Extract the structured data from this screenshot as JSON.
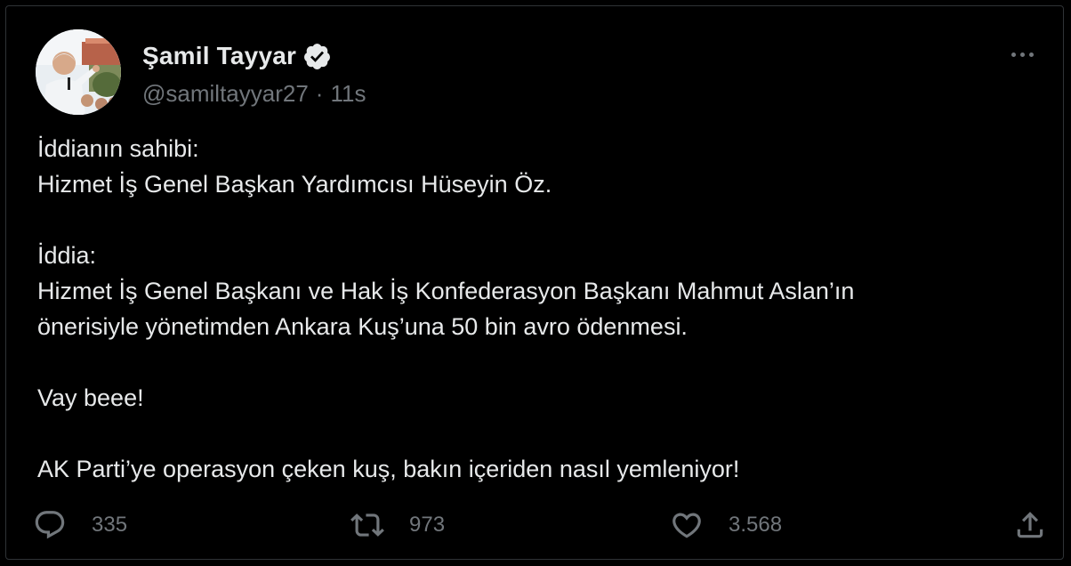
{
  "author": {
    "display_name": "Şamil Tayyar",
    "handle": "@samiltayyar27",
    "separator": "·",
    "timestamp": "11s",
    "verified": true,
    "avatar_icon": "profile-photo"
  },
  "more_icon": "more-horizontal-icon",
  "tweet": {
    "lines": [
      "İddianın sahibi:",
      "Hizmet İş Genel Başkan Yardımcısı Hüseyin Öz.",
      "",
      "İddia:",
      "Hizmet İş Genel Başkanı ve Hak İş Konfederasyon Başkanı Mahmut Aslan’ın",
      "önerisiyle yönetimden Ankara Kuş’una 50 bin avro ödenmesi.",
      "",
      "Vay beee!",
      "",
      "AK Parti’ye operasyon çeken kuş, bakın içeriden nasıl yemleniyor!"
    ]
  },
  "actions": {
    "replies": "335",
    "retweets": "973",
    "likes": "3.568",
    "reply_icon": "reply-icon",
    "retweet_icon": "retweet-icon",
    "like_icon": "heart-icon",
    "share_icon": "share-icon"
  },
  "colors": {
    "background": "#000000",
    "text_primary": "#e7e9ea",
    "text_secondary": "#71767b",
    "border": "#2f3336",
    "verified_badge": "#e7e9ea"
  }
}
